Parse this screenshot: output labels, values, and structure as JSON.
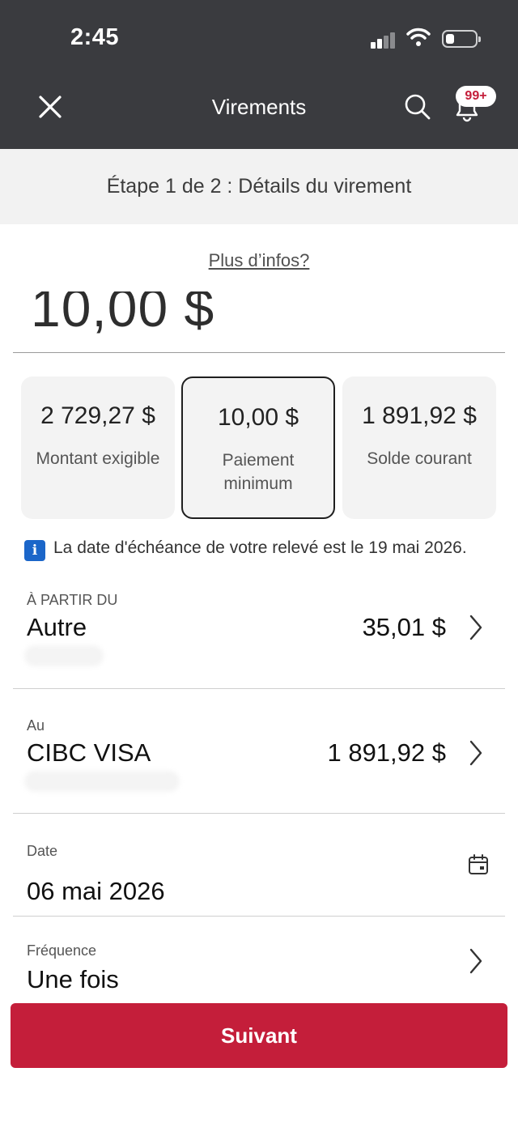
{
  "status_bar": {
    "time": "2:45"
  },
  "nav": {
    "title": "Virements",
    "notification_badge": "99+",
    "icons": {
      "close": "close-icon",
      "search": "search-icon",
      "notifications": "bell-icon"
    }
  },
  "step": {
    "text": "Étape 1 de 2 : Détails du virement"
  },
  "more_info": "Plus d’infos?",
  "amount": {
    "value": "10,00 $"
  },
  "payment_options": [
    {
      "amount": "2 729,27 $",
      "label": "Montant exigible",
      "selected": false
    },
    {
      "amount": "10,00 $",
      "label": "Paiement minimum",
      "selected": true
    },
    {
      "amount": "1 891,92 $",
      "label": "Solde courant",
      "selected": false
    }
  ],
  "info": {
    "text": "La date d'échéance de votre relevé est le 19 mai 2026."
  },
  "from": {
    "label": "À PARTIR DU",
    "account": "Autre",
    "balance": "35,01 $"
  },
  "to": {
    "label": "Au",
    "account": "CIBC VISA",
    "balance": "1 891,92 $"
  },
  "date": {
    "label": "Date",
    "value": "06 mai 2026"
  },
  "frequency": {
    "label": "Fréquence",
    "value": "Une fois"
  },
  "next_button": "Suivant",
  "colors": {
    "header_bg": "#3a3b3f",
    "primary": "#c41e3a",
    "info": "#1b66c9"
  }
}
